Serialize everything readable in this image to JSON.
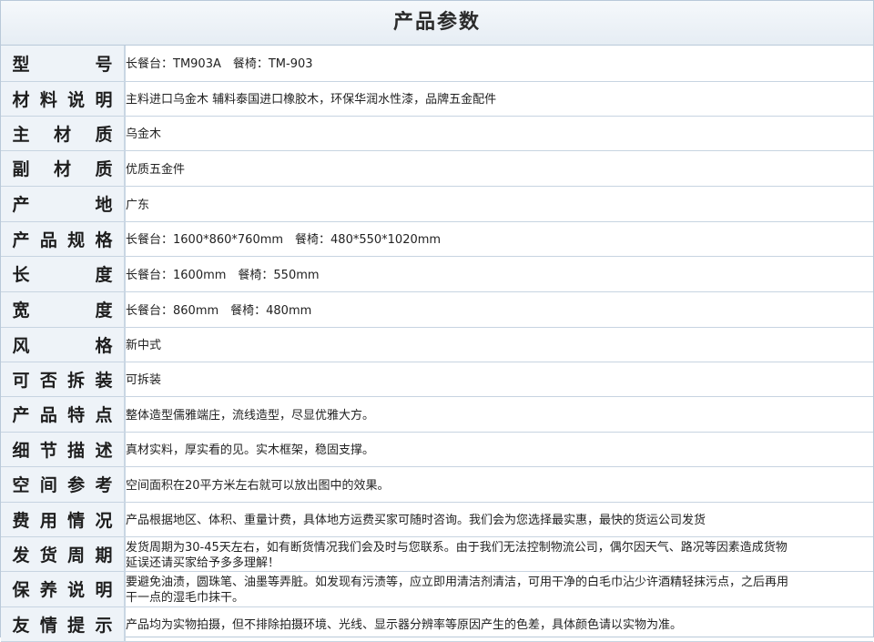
{
  "title": "产品参数",
  "rows": [
    {
      "label": "型　　号",
      "value": "长餐台：TM903A　餐椅：TM-903"
    },
    {
      "label": "材料说明",
      "value": "主料进口乌金木 辅料泰国进口橡胶木，环保华润水性漆，品牌五金配件"
    },
    {
      "label": "主 材 质",
      "value": "乌金木"
    },
    {
      "label": "副 材 质",
      "value": "优质五金件"
    },
    {
      "label": "产　　地",
      "value": "广东"
    },
    {
      "label": "产品规格",
      "value": "长餐台：1600*860*760mm　餐椅：480*550*1020mm"
    },
    {
      "label": "长　　度",
      "value": "长餐台：1600mm　餐椅：550mm"
    },
    {
      "label": "宽　　度",
      "value": "长餐台：860mm　餐椅：480mm"
    },
    {
      "label": "风　　格",
      "value": "新中式"
    },
    {
      "label": "可否拆装",
      "value": "可拆装"
    },
    {
      "label": "产品特点",
      "value": "整体造型儒雅端庄，流线造型，尽显优雅大方。"
    },
    {
      "label": "细节描述",
      "value": "真材实料，厚实看的见。实木框架，稳固支撑。"
    },
    {
      "label": "空间参考",
      "value": "空间面积在20平方米左右就可以放出图中的效果。"
    },
    {
      "label": "费用情况",
      "value": "产品根据地区、体积、重量计费，具体地方运费买家可随时咨询。我们会为您选择最实惠，最快的货运公司发货"
    },
    {
      "label": "发货周期",
      "value": "发货周期为30-45天左右，如有断货情况我们会及时与您联系。由于我们无法控制物流公司，偶尔因天气、路况等因素造成货物延误还请买家给予多多理解！"
    },
    {
      "label": "保养说明",
      "value": "要避免油渍，圆珠笔、油墨等弄脏。如发现有污渍等，应立即用清洁剂清洁，可用干净的白毛巾沾少许酒精轻抹污点，之后再用干一点的湿毛巾抹干。"
    },
    {
      "label": "友情提示",
      "value": "产品均为实物拍摄，但不排除拍摄环境、光线、显示器分辨率等原因产生的色差，具体颜色请以实物为准。"
    }
  ]
}
